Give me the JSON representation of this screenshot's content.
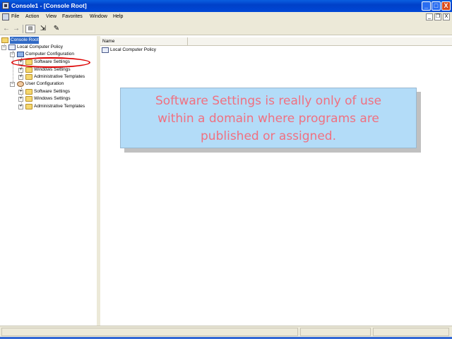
{
  "window": {
    "title": "Console1 - [Console Root]",
    "minimize": "_",
    "maximize": "□",
    "close": "X"
  },
  "menu": {
    "items": [
      "File",
      "Action",
      "View",
      "Favorites",
      "Window",
      "Help"
    ],
    "mdi_minimize": "_",
    "mdi_restore": "❐",
    "mdi_close": "X"
  },
  "toolbar": {
    "back": "←",
    "forward": "→",
    "show_hide_tree": "▤",
    "export": "⇲",
    "properties": "✎"
  },
  "tree": {
    "root": "Console Root",
    "local_policy": "Local Computer Policy",
    "computer_config": "Computer Configuration",
    "cc_software": "Software Settings",
    "cc_windows": "Windows Settings",
    "cc_admin": "Administrative Templates",
    "user_config": "User Configuration",
    "uc_software": "Software Settings",
    "uc_windows": "Windows Settings",
    "uc_admin": "Administrative Templates",
    "expanded_sign": "−",
    "collapsed_sign": "+"
  },
  "list": {
    "column_name": "Name",
    "rows": [
      "Local Computer Policy"
    ]
  },
  "callout": {
    "line1": "Software Settings is really only of use",
    "line2": "within a domain where programs are",
    "line3": "published or assigned."
  },
  "colors": {
    "callout_bg": "#b3dcf8",
    "callout_text": "#f07080",
    "highlight": "#dd0000",
    "selection": "#316ac5"
  }
}
